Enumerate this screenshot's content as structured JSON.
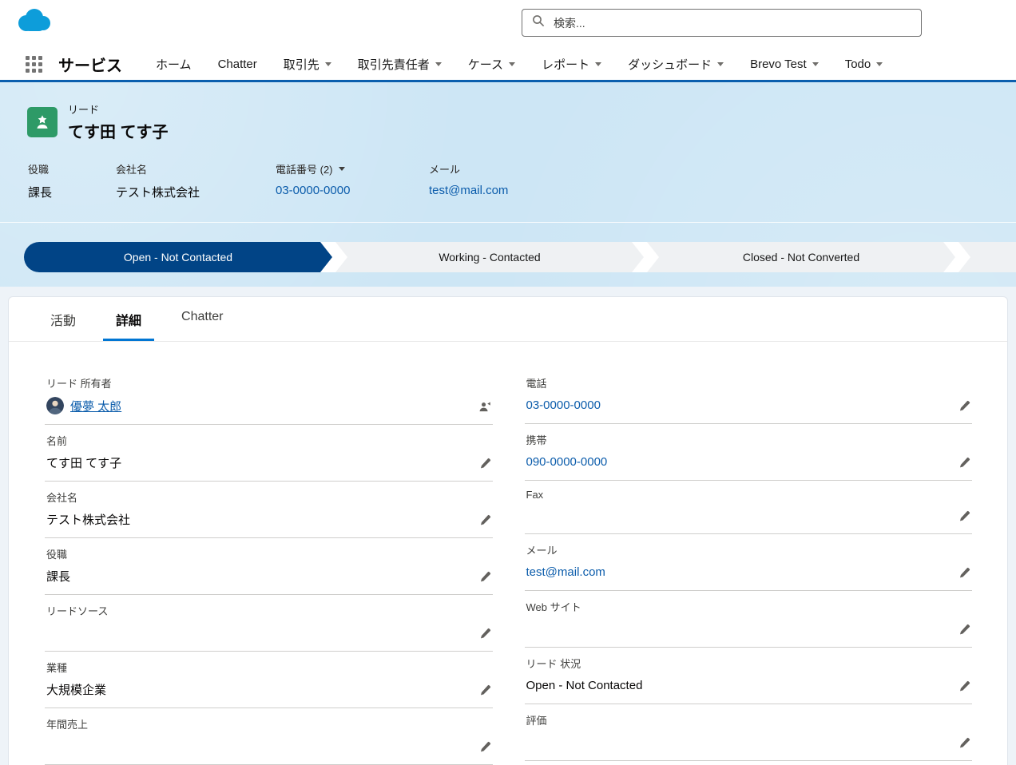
{
  "header": {
    "search_placeholder": "検索..."
  },
  "nav": {
    "app_name": "サービス",
    "items": [
      {
        "key": "home",
        "label": "ホーム",
        "has_dropdown": false
      },
      {
        "key": "chatter",
        "label": "Chatter",
        "has_dropdown": false
      },
      {
        "key": "accounts",
        "label": "取引先",
        "has_dropdown": true
      },
      {
        "key": "contacts",
        "label": "取引先責任者",
        "has_dropdown": true
      },
      {
        "key": "cases",
        "label": "ケース",
        "has_dropdown": true
      },
      {
        "key": "reports",
        "label": "レポート",
        "has_dropdown": true
      },
      {
        "key": "dashboards",
        "label": "ダッシュボード",
        "has_dropdown": true
      },
      {
        "key": "brevo-test",
        "label": "Brevo Test",
        "has_dropdown": true
      },
      {
        "key": "todo",
        "label": "Todo",
        "has_dropdown": true
      }
    ]
  },
  "record": {
    "object_label": "リード",
    "name": "てす田 てす子",
    "highlight_fields": [
      {
        "key": "title",
        "label": "役職",
        "value": "課長",
        "type": "text",
        "has_dropdown": false
      },
      {
        "key": "company",
        "label": "会社名",
        "value": "テスト株式会社",
        "type": "text",
        "has_dropdown": false
      },
      {
        "key": "phone",
        "label": "電話番号 (2)",
        "value": "03-0000-0000",
        "type": "link",
        "has_dropdown": true
      },
      {
        "key": "email",
        "label": "メール",
        "value": "test@mail.com",
        "type": "link",
        "has_dropdown": false
      }
    ]
  },
  "path": {
    "stages": [
      {
        "key": "open-not-contacted",
        "label": "Open - Not Contacted",
        "state": "current"
      },
      {
        "key": "working-contacted",
        "label": "Working - Contacted",
        "state": "incomplete"
      },
      {
        "key": "closed-not-converted",
        "label": "Closed - Not Converted",
        "state": "incomplete"
      },
      {
        "key": "next-stage",
        "label": "",
        "state": "incomplete"
      }
    ]
  },
  "tabs": [
    {
      "key": "activity",
      "label": "活動",
      "active": false
    },
    {
      "key": "details",
      "label": "詳細",
      "active": true
    },
    {
      "key": "chatter",
      "label": "Chatter",
      "active": false
    }
  ],
  "details": {
    "left": [
      {
        "key": "lead-owner",
        "label": "リード 所有者",
        "value": "優夢 太郎",
        "type": "owner"
      },
      {
        "key": "name",
        "label": "名前",
        "value": "てす田 てす子",
        "type": "text"
      },
      {
        "key": "company",
        "label": "会社名",
        "value": "テスト株式会社",
        "type": "text"
      },
      {
        "key": "title",
        "label": "役職",
        "value": "課長",
        "type": "text"
      },
      {
        "key": "lead-source",
        "label": "リードソース",
        "value": "",
        "type": "text"
      },
      {
        "key": "industry",
        "label": "業種",
        "value": "大規模企業",
        "type": "text"
      },
      {
        "key": "annual-revenue",
        "label": "年間売上",
        "value": "",
        "type": "text"
      }
    ],
    "right": [
      {
        "key": "phone",
        "label": "電話",
        "value": "03-0000-0000",
        "type": "link"
      },
      {
        "key": "mobile",
        "label": "携帯",
        "value": "090-0000-0000",
        "type": "link"
      },
      {
        "key": "fax",
        "label": "Fax",
        "value": "",
        "type": "text"
      },
      {
        "key": "email",
        "label": "メール",
        "value": "test@mail.com",
        "type": "link"
      },
      {
        "key": "website",
        "label": "Web サイト",
        "value": "",
        "type": "text"
      },
      {
        "key": "lead-status",
        "label": "リード 状況",
        "value": "Open - Not Contacted",
        "type": "text"
      },
      {
        "key": "rating",
        "label": "評価",
        "value": "",
        "type": "text"
      }
    ]
  },
  "colors": {
    "brand_blue": "#0176d3",
    "link_blue": "#0b5cab",
    "path_current": "#014486",
    "path_incomplete": "#eff1f3",
    "lead_icon_green": "#2e9a67",
    "record_band_bg": "#cde6f5"
  }
}
